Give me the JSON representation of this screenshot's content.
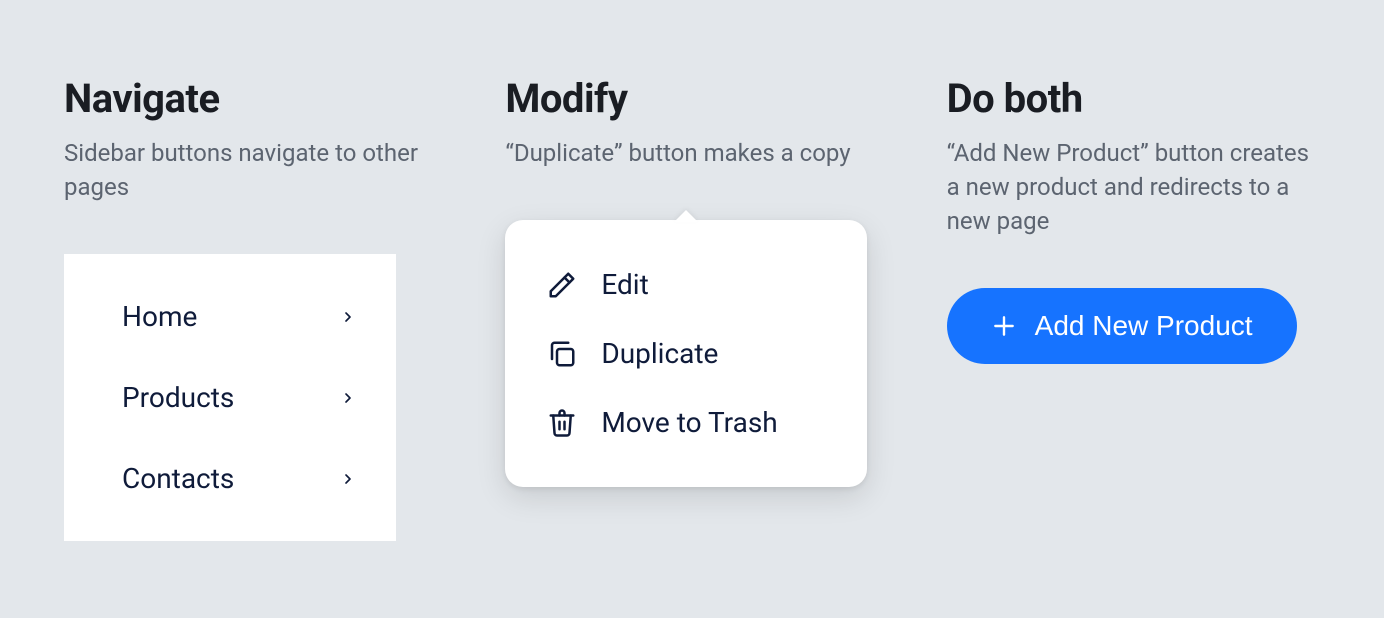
{
  "columns": {
    "navigate": {
      "title": "Navigate",
      "description": "Sidebar buttons navigate to other pages",
      "items": [
        {
          "label": "Home"
        },
        {
          "label": "Products"
        },
        {
          "label": "Contacts"
        }
      ]
    },
    "modify": {
      "title": "Modify",
      "description": "“Duplicate” button makes a copy",
      "items": [
        {
          "label": "Edit",
          "icon": "pencil-icon"
        },
        {
          "label": "Duplicate",
          "icon": "copy-icon"
        },
        {
          "label": "Move to Trash",
          "icon": "trash-icon"
        }
      ]
    },
    "doboth": {
      "title": "Do both",
      "description": "“Add New Product” button creates a new product and redirects to a new page",
      "button_label": "Add New Product"
    }
  }
}
